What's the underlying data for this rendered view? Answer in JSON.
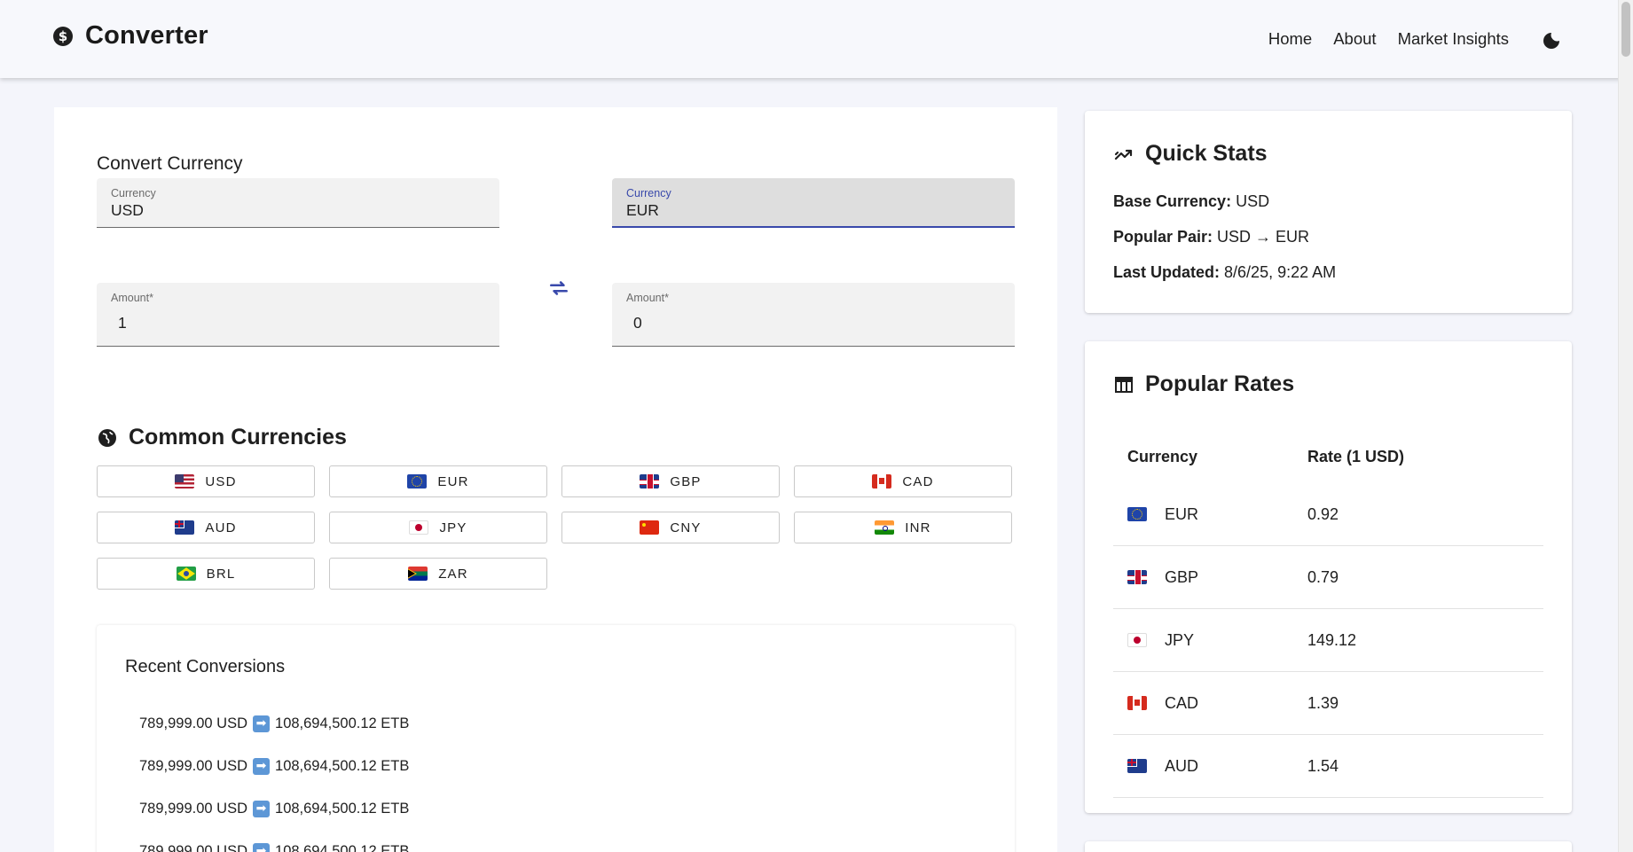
{
  "header": {
    "brand_icon_glyph": "$",
    "title": "Converter",
    "nav": [
      "Home",
      "About",
      "Market Insights"
    ],
    "theme_icon": "moon-icon"
  },
  "converter": {
    "section_title": "Convert Currency",
    "from_currency": {
      "label": "Currency",
      "value": "USD"
    },
    "to_currency": {
      "label": "Currency",
      "value": "EUR"
    },
    "from_amount": {
      "label": "Amount*",
      "value": "1"
    },
    "to_amount": {
      "label": "Amount*",
      "value": "0"
    },
    "swap_icon": "swap-arrows-icon",
    "accent_color": "#3949ab"
  },
  "common": {
    "title": "Common Currencies",
    "icon": "globe-icon",
    "currencies": [
      {
        "code": "USD",
        "flag": "us"
      },
      {
        "code": "EUR",
        "flag": "eu"
      },
      {
        "code": "GBP",
        "flag": "gb"
      },
      {
        "code": "CAD",
        "flag": "ca"
      },
      {
        "code": "AUD",
        "flag": "au"
      },
      {
        "code": "JPY",
        "flag": "jp"
      },
      {
        "code": "CNY",
        "flag": "cn"
      },
      {
        "code": "INR",
        "flag": "in"
      },
      {
        "code": "BRL",
        "flag": "br"
      },
      {
        "code": "ZAR",
        "flag": "za"
      }
    ]
  },
  "recent": {
    "title": "Recent Conversions",
    "items": [
      {
        "from": "789,999.00 USD",
        "to": "108,694,500.12 ETB"
      },
      {
        "from": "789,999.00 USD",
        "to": "108,694,500.12 ETB"
      },
      {
        "from": "789,999.00 USD",
        "to": "108,694,500.12 ETB"
      },
      {
        "from": "789,999.00 USD",
        "to": "108,694,500.12 ETB"
      }
    ],
    "arrow_glyph": "➡"
  },
  "quick_stats": {
    "title": "Quick Stats",
    "icon": "trending-up-icon",
    "base_label": "Base Currency:",
    "base_value": "USD",
    "pair_label": "Popular Pair:",
    "pair_value": "USD → EUR",
    "updated_label": "Last Updated:",
    "updated_value": "8/6/25, 9:22 AM"
  },
  "popular_rates": {
    "title": "Popular Rates",
    "icon": "table-icon",
    "columns": [
      "Currency",
      "Rate (1 USD)"
    ],
    "rows": [
      {
        "flag": "eu",
        "code": "EUR",
        "rate": "0.92"
      },
      {
        "flag": "gb",
        "code": "GBP",
        "rate": "0.79"
      },
      {
        "flag": "jp",
        "code": "JPY",
        "rate": "149.12"
      },
      {
        "flag": "ca",
        "code": "CAD",
        "rate": "1.39"
      },
      {
        "flag": "au",
        "code": "AUD",
        "rate": "1.54"
      }
    ]
  }
}
